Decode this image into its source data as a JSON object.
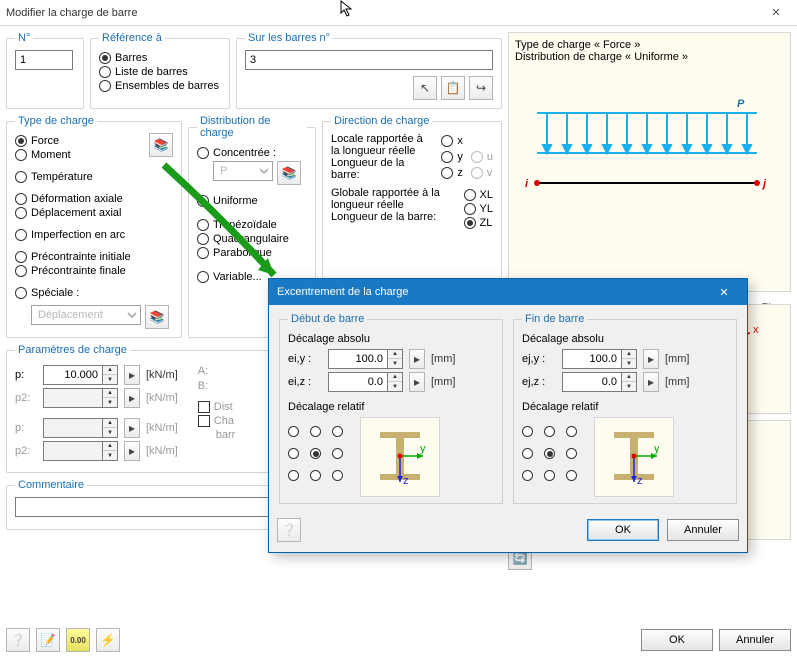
{
  "title": "Modifier la charge de barre",
  "groups": {
    "num": {
      "legend": "N°",
      "value": "1"
    },
    "ref": {
      "legend": "Référence à",
      "opts": [
        "Barres",
        "Liste de barres",
        "Ensembles de barres"
      ],
      "selected": 0
    },
    "bars": {
      "legend": "Sur les barres n°",
      "value": "3"
    }
  },
  "loadtype": {
    "legend": "Type de charge",
    "opts": [
      "Force",
      "Moment",
      "Température",
      "Déformation axiale",
      "Déplacement axial",
      "Imperfection en arc",
      "Précontrainte initiale",
      "Précontrainte finale",
      "Spéciale :"
    ],
    "selected": 0,
    "special_combo": "Déplacement"
  },
  "dist": {
    "legend": "Distribution de charge",
    "concentrated": "Concentrée :",
    "conc_combo": "P",
    "opts": [
      "Uniforme",
      "Trapézoïdale",
      "Quadrangulaire",
      "Parabolique",
      "Variable..."
    ],
    "selected": 0
  },
  "dir": {
    "legend": "Direction de charge",
    "local_hdr": "Locale rapportée à la longueur réelle",
    "local_sub": "Longueur de la barre:",
    "global_hdr": "Globale rapportée à la longueur réelle",
    "global_sub": "Longueur de la barre:",
    "opts_local": [
      "x",
      "y",
      "z"
    ],
    "opts_uv": [
      "u",
      "v"
    ],
    "opts_global": [
      "XL",
      "YL",
      "ZL"
    ],
    "selected_global": 2
  },
  "params": {
    "legend": "Paramètres de charge",
    "rows": [
      {
        "lbl": "p:",
        "val": "10.000",
        "unit": "[kN/m]",
        "rlbl": "A:"
      },
      {
        "lbl": "p2:",
        "val": "",
        "unit": "[kN/m]",
        "rlbl": "B:"
      },
      {
        "lbl": "p:",
        "val": "",
        "unit": "[kN/m]"
      },
      {
        "lbl": "p2:",
        "val": "",
        "unit": "[kN/m]"
      }
    ],
    "chk_dist": "Dist",
    "chk_cha": "Cha",
    "cha_sub": "barr"
  },
  "comment": {
    "legend": "Commentaire",
    "value": ""
  },
  "preview": {
    "line1": "Type de charge « Force »",
    "line2": "Distribution de charge « Uniforme »",
    "P": "P",
    "i": "i",
    "j": "j",
    "zl_label": "ZL »"
  },
  "modal": {
    "title": "Excentrement de la charge",
    "start_legend": "Début de barre",
    "end_legend": "Fin de barre",
    "abs_legend": "Décalage absolu",
    "rel_legend": "Décalage relatif",
    "eiy_lbl": "ei,y :",
    "eiz_lbl": "ei,z :",
    "ejy_lbl": "ej,y :",
    "ejz_lbl": "ej,z :",
    "eiy": "100.0",
    "eiz": "0.0",
    "ejy": "100.0",
    "ejz": "0.0",
    "mm": "[mm]",
    "ok": "OK",
    "cancel": "Annuler"
  },
  "footer": {
    "ok": "OK",
    "cancel": "Annuler"
  }
}
